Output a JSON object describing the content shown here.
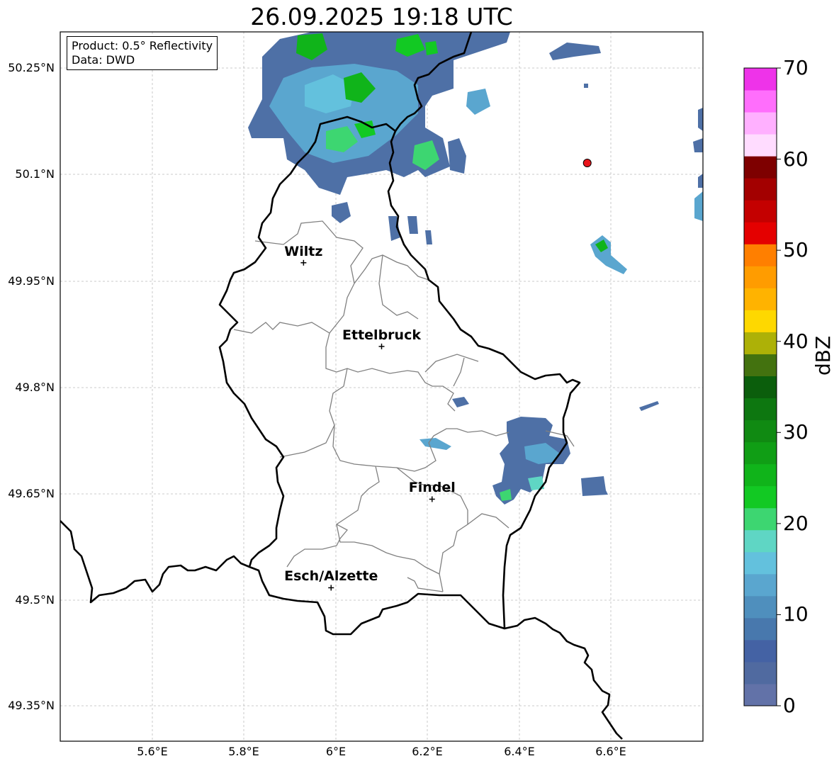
{
  "title": "26.09.2025 19:18 UTC",
  "info": {
    "product": "Product: 0.5° Reflectivity",
    "data": "Data: DWD"
  },
  "lat_ticks": [
    "50.25°N",
    "50.1°N",
    "49.95°N",
    "49.8°N",
    "49.65°N",
    "49.5°N",
    "49.35°N"
  ],
  "lon_ticks": [
    "5.6°E",
    "5.8°E",
    "6°E",
    "6.2°E",
    "6.4°E",
    "6.6°E"
  ],
  "cities": [
    {
      "name": "Wiltz",
      "lon": 5.93,
      "lat": 49.966
    },
    {
      "name": "Ettelbruck",
      "lon": 6.1,
      "lat": 49.846
    },
    {
      "name": "Findel",
      "lon": 6.21,
      "lat": 49.627
    },
    {
      "name": "Esch/Alzette",
      "lon": 5.99,
      "lat": 49.5
    }
  ],
  "radar_site": {
    "lon": 6.548,
    "lat": 50.109,
    "color": "#e8141b"
  },
  "colorbar": {
    "label": "dBZ",
    "min": 0,
    "max": 70,
    "tick_labels": [
      "0",
      "10",
      "20",
      "30",
      "40",
      "50",
      "60",
      "70"
    ],
    "colors": [
      "#6272a8",
      "#506aa0",
      "#4462a4",
      "#4878ad",
      "#4f8fbd",
      "#5aa6cf",
      "#63c1dd",
      "#5fd6c4",
      "#3dd671",
      "#12c923",
      "#10b41a",
      "#109e15",
      "#108a12",
      "#0d7710",
      "#0b5e0c",
      "#43720f",
      "#adb107",
      "#fed800",
      "#ffb300",
      "#ff9c00",
      "#ff7f00",
      "#e40000",
      "#c40000",
      "#a30000",
      "#7e0000",
      "#ffdcff",
      "#ffb0ff",
      "#ff6efc",
      "#ee33e9"
    ]
  },
  "echo_regions": [
    {
      "lon": [
        5.8,
        6.35
      ],
      "lat": [
        50.1,
        50.29
      ],
      "level": "weak-moderate",
      "max_dbz": 25
    },
    {
      "lon": [
        6.39,
        6.52
      ],
      "lat": [
        49.62,
        49.76
      ],
      "level": "weak",
      "max_dbz": 18
    },
    {
      "lon": [
        6.18,
        6.25
      ],
      "lat": [
        49.71,
        49.73
      ],
      "level": "weak",
      "max_dbz": 16
    },
    {
      "lon": [
        6.54,
        6.61
      ],
      "lat": [
        49.96,
        50.01
      ],
      "level": "weak",
      "max_dbz": 22
    },
    {
      "lon": [
        6.52,
        6.58
      ],
      "lat": [
        49.65,
        49.68
      ],
      "level": "weak",
      "max_dbz": 6
    }
  ]
}
